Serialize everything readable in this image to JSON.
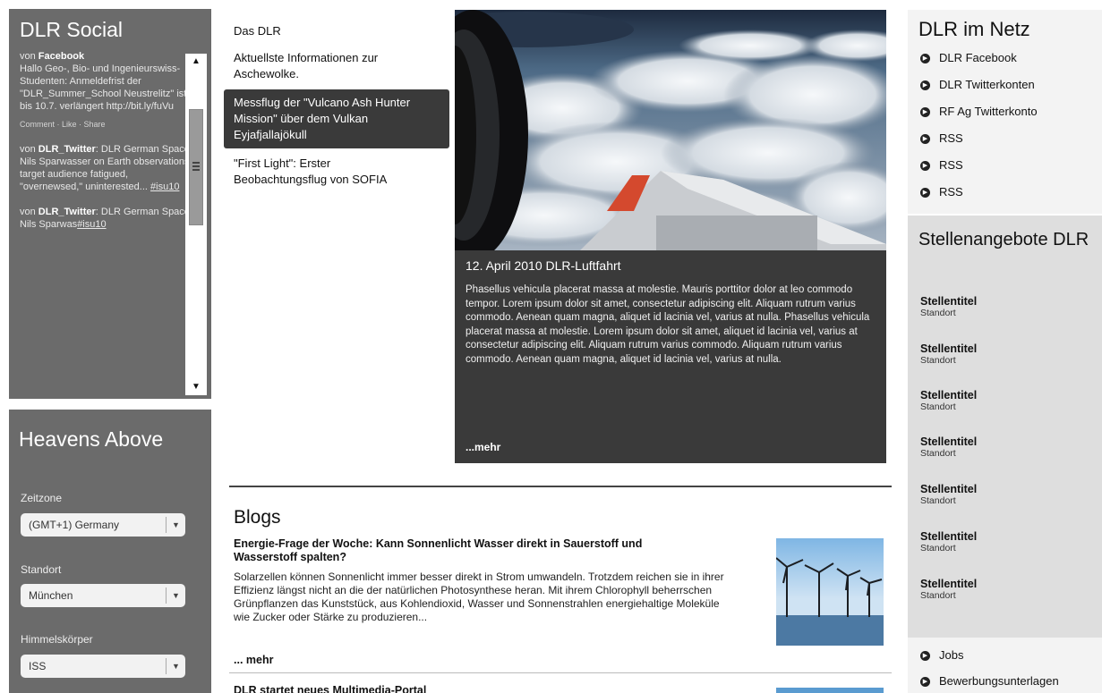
{
  "social": {
    "title": "DLR Social",
    "posts": [
      {
        "prefix": "von ",
        "source": "Facebook",
        "text": "Hallo Geo-, Bio- und Ingenieurswiss-Studenten: Anmeldefrist der \"DLR_Summer_School Neustrelitz\" ist bis 10.7. verlängert http://bit.ly/fuVu",
        "actions": "Comment · Like · Share"
      },
      {
        "prefix": "von ",
        "source": "DLR_Twitter",
        "text": ": DLR German Space Nils Sparwasser on Earth observations: target audience fatigued, \"overnewsed,\" uninterested...",
        "tag": "#isu10"
      },
      {
        "prefix": "von ",
        "source": "DLR_Twitter",
        "text": ": DLR German Space Nils Sparwas",
        "tag": "#isu10"
      }
    ]
  },
  "heavens": {
    "title": "Heavens Above",
    "zeitzone_label": "Zeitzone",
    "zeitzone_value": "(GMT+1) Germany",
    "standort_label": "Standort",
    "standort_value": "München",
    "himmel_label": "Himmelskörper",
    "himmel_value": "ISS"
  },
  "nav": {
    "items": [
      {
        "label": "Das DLR"
      },
      {
        "label": "Aktuellste Informationen zur Aschewolke."
      },
      {
        "label": "Messflug der \"Vulcano Ash Hunter Mission\" über dem Vulkan Eyjafjallajökull"
      },
      {
        "label": "\"First Light\": Erster Beobachtungsflug von SOFIA"
      }
    ]
  },
  "feature": {
    "heading": "12. April 2010 DLR-Luftfahrt",
    "body": "Phasellus vehicula placerat massa at molestie. Mauris porttitor dolor at leo commodo tempor. Lorem ipsum dolor sit amet, consectetur adipiscing elit. Aliquam rutrum varius commodo. Aenean quam magna, aliquet id lacinia vel, varius at nulla. Phasellus vehicula placerat massa at molestie. Lorem ipsum dolor sit amet, aliquet id lacinia vel, varius at consectetur adipiscing elit. Aliquam rutrum varius commodo. Aliquam rutrum varius commodo. Aenean quam magna, aliquet id lacinia vel, varius at nulla.",
    "more": "...mehr"
  },
  "blogs": {
    "heading": "Blogs",
    "title": "Energie-Frage der Woche: Kann Sonnenlicht Wasser direkt in Sauerstoff und Wasserstoff spalten?",
    "text": "Solarzellen können Sonnenlicht immer besser direkt in Strom umwandeln. Trotzdem reichen sie in ihrer Effizienz längst nicht an die der natürlichen Photosynthese heran. Mit ihrem Chlorophyll beherrschen Grünpflanzen das Kunststück, aus Kohlendioxid, Wasser und Sonnenstrahlen energiehaltige Moleküle wie Zucker oder Stärke zu produzieren...",
    "more": "... mehr",
    "next_title": "DLR startet neues Multimedia-Portal"
  },
  "netz": {
    "title": "DLR im Netz",
    "links": [
      "DLR Facebook",
      "DLR Twitterkonten",
      "RF Ag Twitterkonto",
      "RSS",
      "RSS",
      "RSS"
    ]
  },
  "jobs": {
    "title": "Stellenangebote DLR",
    "items": [
      {
        "title": "Stellentitel",
        "location": "Standort"
      },
      {
        "title": "Stellentitel",
        "location": "Standort"
      },
      {
        "title": "Stellentitel",
        "location": "Standort"
      },
      {
        "title": "Stellentitel",
        "location": "Standort"
      },
      {
        "title": "Stellentitel",
        "location": "Standort"
      },
      {
        "title": "Stellentitel",
        "location": "Standort"
      },
      {
        "title": "Stellentitel",
        "location": "Standort"
      }
    ]
  },
  "bottom_links": [
    "Jobs",
    "Bewerbungsunterlagen"
  ]
}
